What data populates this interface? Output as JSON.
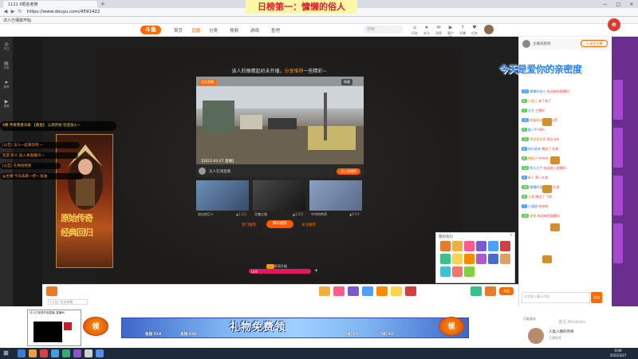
{
  "browser": {
    "tab_title": "1121 0把名老牌",
    "url": "https://www.douyu.com/4591422",
    "bookmark": "法人已保底开始"
  },
  "overlay": {
    "banner_title": "日榜第一：慵懒的俗人",
    "rainbow_text": "今天是爱你的亲密度"
  },
  "site": {
    "logo": "斗鱼",
    "nav": [
      "首页",
      "直播",
      "分类",
      "视频",
      "游戏",
      "鱼吧"
    ],
    "search_placeholder": "搜索",
    "header_icons": [
      {
        "glyph": "⌂",
        "label": "历史"
      },
      {
        "glyph": "★",
        "label": "关注"
      },
      {
        "glyph": "✉",
        "label": "消息"
      },
      {
        "glyph": "▶",
        "label": "客户端"
      },
      {
        "glyph": "↑",
        "label": "开播"
      },
      {
        "glyph": "♥",
        "label": "任务"
      }
    ]
  },
  "left_rail": [
    {
      "glyph": "◎",
      "label": "关注"
    },
    {
      "glyph": "▤",
      "label": "分类"
    },
    {
      "glyph": "★",
      "label": "推荐"
    },
    {
      "glyph": "▶",
      "label": "视频"
    }
  ],
  "player": {
    "offline_prefix": "该人的眼睛起初未开播，",
    "offline_highlight": "分享推荐",
    "offline_suffix": "一些精彩~",
    "rec_tag": "正在直播",
    "rec_fans": "热度",
    "rec_caption": "【2022-03-27 直播】",
    "rec_streamer": "法人在线直播",
    "rec_button": "进入直播间",
    "thumbs": [
      {
        "title": "进击的巨人",
        "views": "▲1.3万"
      },
      {
        "title": "灵魂之旅",
        "views": "▲1.0万"
      },
      {
        "title": "中华的传奇",
        "views": "▲9.5千"
      }
    ],
    "tabs": {
      "more": "热门推荐",
      "active": "精彩推荐",
      "follow": "关注推荐"
    },
    "progress_text": "距离升级",
    "progress_num": "LV.8",
    "progress_plus": "+"
  },
  "game_ad": {
    "line1": "原始传奇",
    "line2": "经典回归"
  },
  "danmu": [
    "4楼 传奇勇者归来 【黄金】 公测开始 欢迎加入~",
    "[公告] 法人一起来玩吧 ~",
    "欢迎 新人 加入本直播间 ~",
    "[公告] 礼物榜更新",
    "@主播 今天再来一把~ 加油"
  ],
  "toolbar": {
    "chat_placeholder": "[公告] 发送弹幕",
    "recharge": "充值",
    "gift_colors": [
      "#e87a2a",
      "#f0b040",
      "#ff5a8a",
      "#7a5ad0",
      "#4aa0ff",
      "#ff8a00",
      "#ffd24a",
      "#d04040",
      "#3ac08a"
    ]
  },
  "gift_popup": {
    "title": "我的背包",
    "close": "×",
    "colors": [
      "#e87a2a",
      "#f0b040",
      "#ff5a8a",
      "#7a5ad0",
      "#4aa0ff",
      "#d04040",
      "#3ac08a",
      "#ffd24a",
      "#ff8a00",
      "#b05ad0",
      "#4a6ad0",
      "#e0a060",
      "#40c0d0",
      "#ff7070",
      "#80d040"
    ]
  },
  "chat": {
    "header_title": "主播贡献榜",
    "header_button": "+ 关注主播",
    "messages": [
      {
        "lv": "12",
        "name": "慵懒的俗人",
        "text": "欢迎来到直播间"
      },
      {
        "lv": "9",
        "name": "小鱼儿",
        "text": "来了来了"
      },
      {
        "lv": "7",
        "name": "无名",
        "text": "主播好"
      },
      {
        "lv": "15",
        "name": "超级粉丝",
        "text": "送出 火箭"
      },
      {
        "lv": "5",
        "name": "路人甲",
        "text": "666"
      },
      {
        "lv": "11",
        "name": "传奇老玩家",
        "text": "怀念当年"
      },
      {
        "lv": "8",
        "name": "快乐星球",
        "text": "赠送了 礼物"
      },
      {
        "lv": "6",
        "name": "夜猫子",
        "text": "冲冲冲"
      },
      {
        "lv": "13",
        "name": "鱼丸大户",
        "text": "欢迎进入直播间"
      },
      {
        "lv": "4",
        "name": "新人",
        "text": "第一次来"
      },
      {
        "lv": "10",
        "name": "慵懒的俗人",
        "text": "谢谢大家"
      },
      {
        "lv": "9",
        "name": "江湖",
        "text": "赠送了 飞机"
      },
      {
        "lv": "7",
        "name": "小甜甜",
        "text": "哈哈哈"
      },
      {
        "lv": "14",
        "name": "老铁",
        "text": "欢迎来到直播间"
      }
    ],
    "input_placeholder": "这里输入聊天内容",
    "send": "发送"
  },
  "bottom_banner": {
    "text": "礼物免费领",
    "ling": "领",
    "planes": [
      "鱼翅 X10",
      "鱼翅 X30",
      "飞机 X1",
      "飞机 X2"
    ]
  },
  "preview": {
    "title": "法人已保底开始直播_直播间"
  },
  "rec_bottom": {
    "title": "可能喜欢",
    "name": "人类人圈的传奇",
    "sub": "主播推荐",
    "activate": "激活 Windows"
  },
  "taskbar": {
    "start": "⊞",
    "time": "0:00",
    "date": "2022/3/27",
    "icons": [
      "#3a7bd5",
      "#f0a030",
      "#e04040",
      "#40a0e0",
      "#30b070",
      "#9050d0",
      "#d0d0d0",
      "#5090f0"
    ]
  }
}
